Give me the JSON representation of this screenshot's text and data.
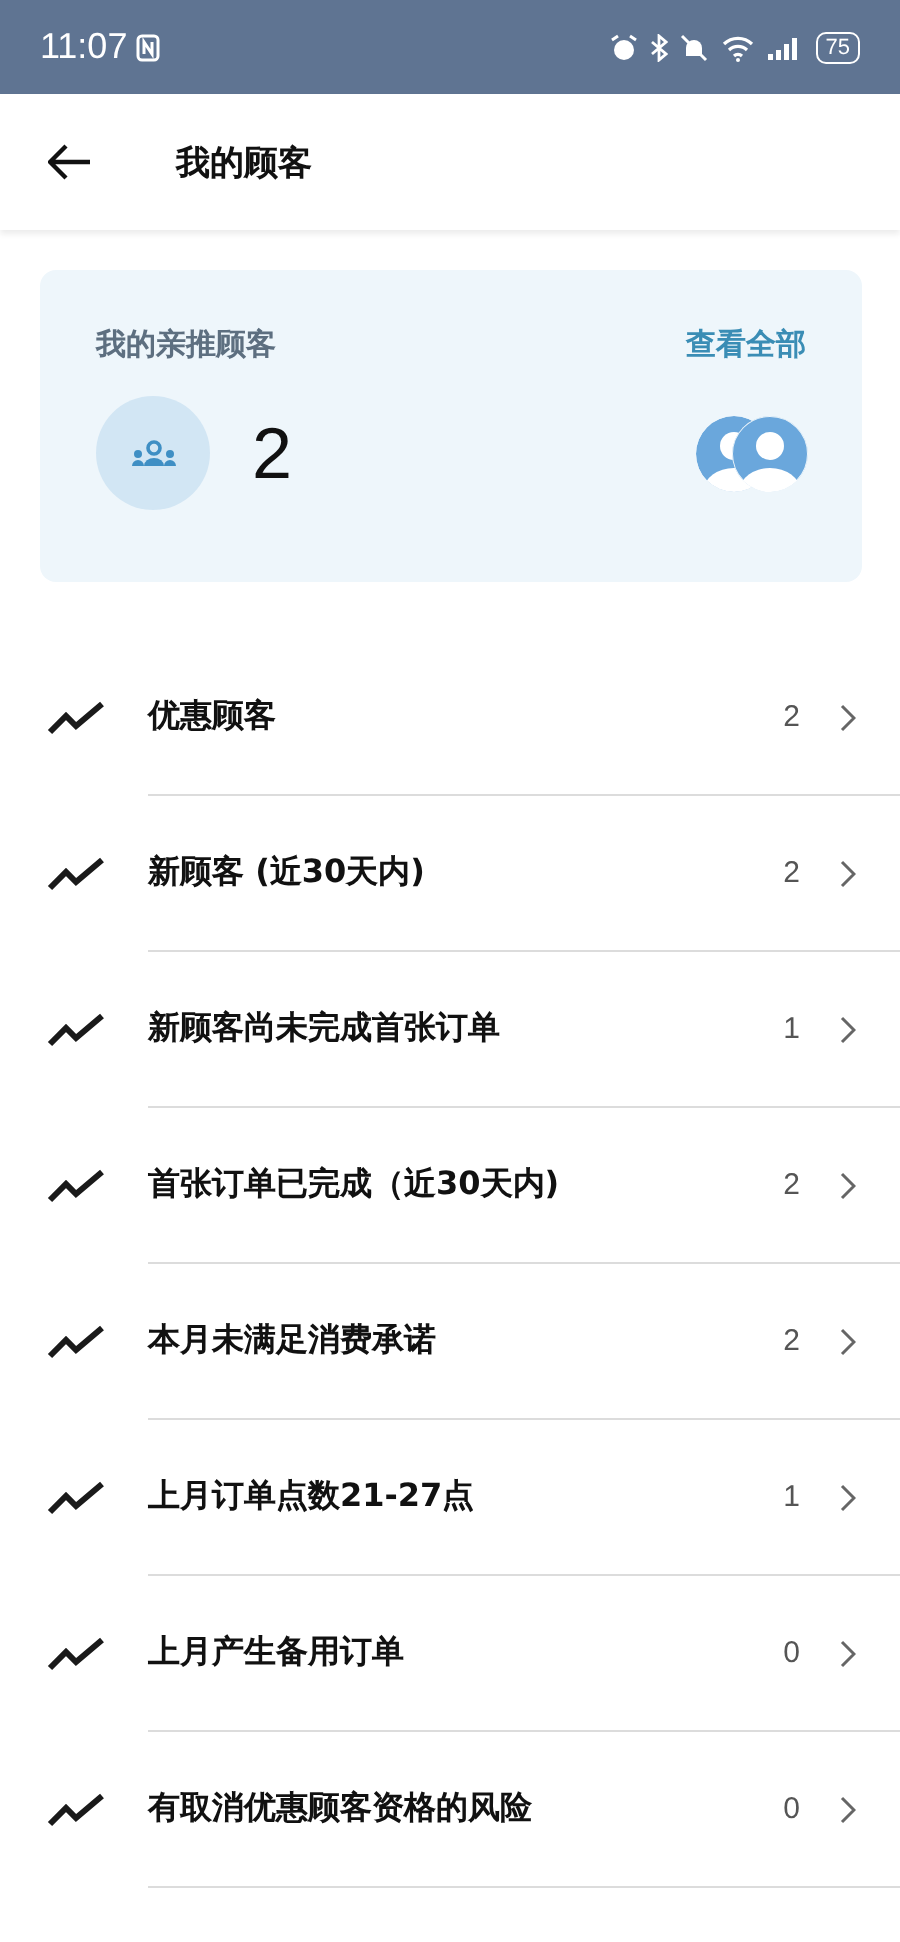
{
  "status_bar": {
    "time": "11:07",
    "battery": "75"
  },
  "header": {
    "title": "我的顾客"
  },
  "summary_card": {
    "title": "我的亲推顾客",
    "link": "查看全部",
    "count": "2"
  },
  "rows": [
    {
      "label": "优惠顾客",
      "count": "2"
    },
    {
      "label": "新顾客 (近30天内)",
      "count": "2"
    },
    {
      "label": "新顾客尚未完成首张订单",
      "count": "1"
    },
    {
      "label": "首张订单已完成（近30天内)",
      "count": "2"
    },
    {
      "label": "本月未满足消费承诺",
      "count": "2"
    },
    {
      "label": "上月订单点数21-27点",
      "count": "1"
    },
    {
      "label": "上月产生备用订单",
      "count": "0"
    },
    {
      "label": "有取消优惠顾客资格的风险",
      "count": "0"
    }
  ]
}
